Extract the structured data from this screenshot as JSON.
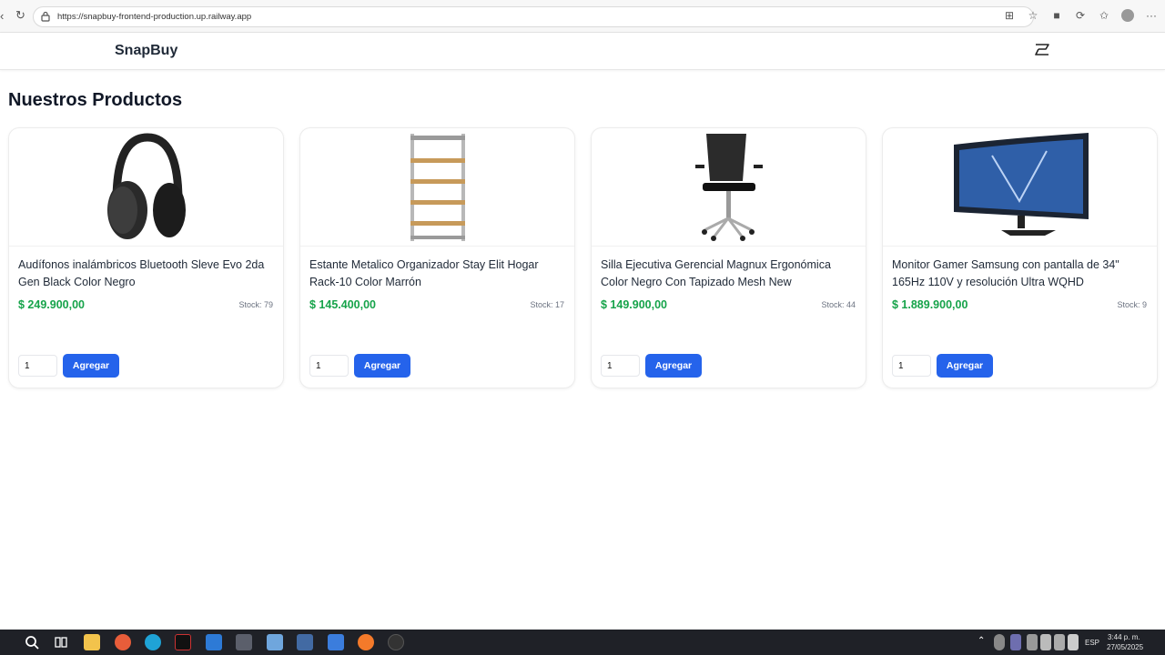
{
  "browser": {
    "url": "https://snapbuy-frontend-production.up.railway.app"
  },
  "header": {
    "brand": "SnapBuy"
  },
  "main": {
    "title": "Nuestros Productos"
  },
  "products": [
    {
      "name": "Audífonos inalámbricos Bluetooth Sleve Evo 2da Gen Black Color Negro",
      "price": "$ 249.900,00",
      "stock": "Stock: 79",
      "qty": "1",
      "add_label": "Agregar",
      "image_icon": "headphones-icon"
    },
    {
      "name": "Estante Metalico Organizador Stay Elit Hogar Rack-10 Color Marrón",
      "price": "$ 145.400,00",
      "stock": "Stock: 17",
      "qty": "1",
      "add_label": "Agregar",
      "image_icon": "shelf-icon"
    },
    {
      "name": "Silla Ejecutiva Gerencial Magnux Ergonómica Color Negro Con Tapizado Mesh New",
      "price": "$ 149.900,00",
      "stock": "Stock: 44",
      "qty": "1",
      "add_label": "Agregar",
      "image_icon": "office-chair-icon"
    },
    {
      "name": "Monitor Gamer Samsung con pantalla de 34\" 165Hz 110V y resolución Ultra WQHD",
      "price": "$ 1.889.900,00",
      "stock": "Stock: 9",
      "qty": "1",
      "add_label": "Agregar",
      "image_icon": "monitor-icon"
    }
  ],
  "taskbar": {
    "lang": "ESP",
    "time": "3:44 p. m.",
    "date": "27/05/2025"
  },
  "colors": {
    "price": "#16a34a",
    "button": "#2563eb"
  }
}
